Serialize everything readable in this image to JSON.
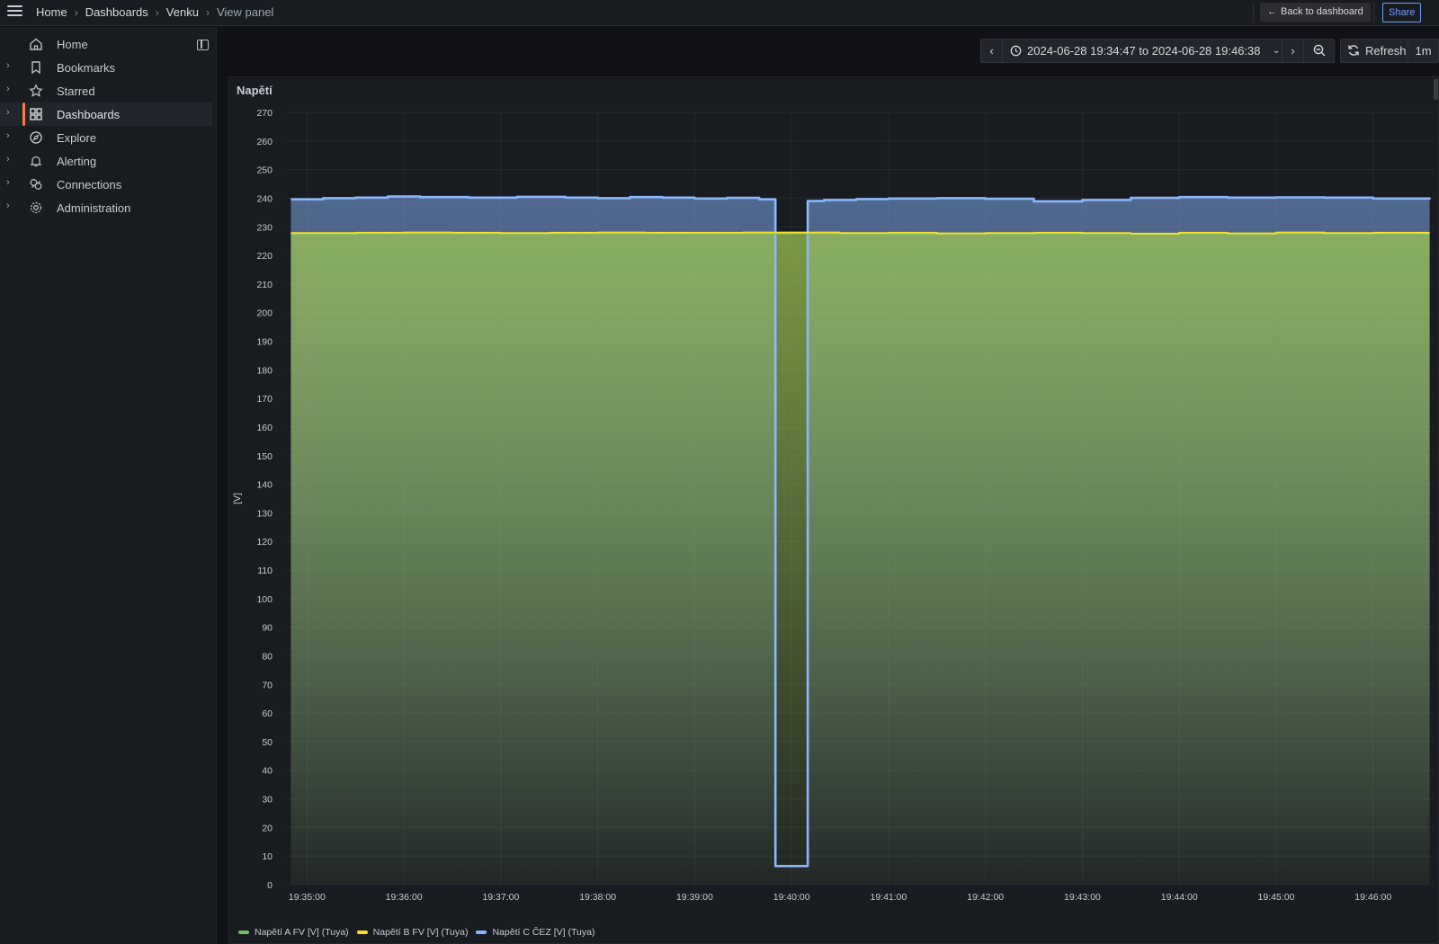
{
  "topbar": {
    "breadcrumb": [
      "Home",
      "Dashboards",
      "Venku",
      "View panel"
    ],
    "back_label": "Back to dashboard",
    "share_label": "Share"
  },
  "sidebar": {
    "items": [
      {
        "label": "Home",
        "icon": "home-icon"
      },
      {
        "label": "Bookmarks",
        "icon": "bookmark-icon"
      },
      {
        "label": "Starred",
        "icon": "star-icon"
      },
      {
        "label": "Dashboards",
        "icon": "dashboards-icon",
        "active": true
      },
      {
        "label": "Explore",
        "icon": "compass-icon"
      },
      {
        "label": "Alerting",
        "icon": "bell-icon"
      },
      {
        "label": "Connections",
        "icon": "connections-icon"
      },
      {
        "label": "Administration",
        "icon": "gear-icon"
      }
    ]
  },
  "timepicker": {
    "range": "2024-06-28 19:34:47 to 2024-06-28 19:46:38",
    "refresh_label": "Refresh",
    "interval": "1m"
  },
  "panel": {
    "title": "Napětí"
  },
  "colors": {
    "series_a": "#73bf69",
    "series_b": "#fade2a",
    "series_c": "#8ab8ff",
    "accent": "#ff7941"
  },
  "chart_data": {
    "type": "area",
    "ylabel": "[V]",
    "ylim": [
      0,
      270
    ],
    "yticks": [
      270,
      260,
      250,
      240,
      230,
      220,
      210,
      200,
      190,
      180,
      170,
      160,
      150,
      140,
      130,
      120,
      110,
      100,
      90,
      80,
      70,
      60,
      50,
      40,
      30,
      20,
      10,
      0
    ],
    "xlim": [
      "19:34:47",
      "19:46:38"
    ],
    "xticks": [
      "19:35:00",
      "19:36:00",
      "19:37:00",
      "19:38:00",
      "19:39:00",
      "19:40:00",
      "19:41:00",
      "19:42:00",
      "19:43:00",
      "19:44:00",
      "19:45:00",
      "19:46:00"
    ],
    "grid": true,
    "legend_position": "bottom-left",
    "series": [
      {
        "name": "Napětí A FV [V] (Tuya)",
        "x": [
          "19:34:50",
          "19:35:30",
          "19:36:00",
          "19:36:30",
          "19:37:00",
          "19:37:30",
          "19:38:00",
          "19:38:30",
          "19:39:00",
          "19:39:30",
          "19:40:00",
          "19:40:30",
          "19:41:00",
          "19:41:30",
          "19:42:00",
          "19:42:30",
          "19:43:00",
          "19:43:30",
          "19:44:00",
          "19:44:30",
          "19:45:00",
          "19:45:30",
          "19:46:00",
          "19:46:35"
        ],
        "values": [
          227.5,
          227.6,
          227.8,
          227.7,
          227.6,
          227.7,
          227.8,
          227.6,
          227.7,
          227.7,
          227.8,
          227.6,
          227.5,
          227.6,
          227.4,
          227.6,
          227.5,
          227.3,
          227.6,
          227.4,
          227.7,
          227.5,
          227.6,
          227.6
        ]
      },
      {
        "name": "Napětí B FV [V] (Tuya)",
        "x": [
          "19:34:50",
          "19:35:30",
          "19:36:00",
          "19:36:30",
          "19:37:00",
          "19:37:30",
          "19:38:00",
          "19:38:30",
          "19:39:00",
          "19:39:30",
          "19:40:00",
          "19:40:30",
          "19:41:00",
          "19:41:30",
          "19:42:00",
          "19:42:30",
          "19:43:00",
          "19:43:30",
          "19:44:00",
          "19:44:30",
          "19:45:00",
          "19:45:30",
          "19:46:00",
          "19:46:35"
        ],
        "values": [
          227.8,
          227.9,
          228.0,
          227.9,
          227.8,
          227.9,
          228.0,
          227.9,
          227.9,
          228.0,
          228.0,
          227.8,
          227.9,
          227.7,
          227.8,
          227.9,
          227.8,
          227.6,
          227.9,
          227.7,
          228.0,
          227.8,
          227.9,
          227.9
        ]
      },
      {
        "name": "Napětí C ČEZ [V] (Tuya)",
        "x": [
          "19:34:50",
          "19:35:10",
          "19:35:30",
          "19:35:50",
          "19:36:10",
          "19:36:40",
          "19:37:10",
          "19:37:40",
          "19:38:00",
          "19:38:20",
          "19:38:40",
          "19:39:00",
          "19:39:20",
          "19:39:40",
          "19:39:50",
          "19:40:00",
          "19:40:10",
          "19:40:20",
          "19:40:40",
          "19:41:00",
          "19:41:30",
          "19:42:00",
          "19:42:30",
          "19:43:00",
          "19:43:30",
          "19:44:00",
          "19:44:30",
          "19:45:00",
          "19:45:30",
          "19:46:00",
          "19:46:35"
        ],
        "values": [
          239.6,
          240.0,
          240.2,
          240.6,
          240.4,
          240.2,
          240.5,
          240.2,
          240.0,
          240.4,
          240.2,
          239.9,
          240.1,
          239.6,
          6.5,
          6.5,
          239.0,
          239.4,
          239.7,
          239.9,
          240.0,
          239.8,
          238.9,
          239.4,
          240.1,
          240.4,
          240.2,
          240.3,
          240.2,
          239.9,
          239.6
        ]
      }
    ]
  }
}
